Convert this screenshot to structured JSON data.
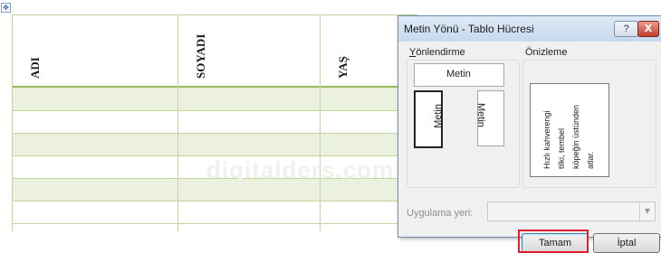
{
  "document": {
    "table": {
      "headers": [
        "ADI",
        "SOYADI",
        "YAŞ"
      ],
      "row_count": 6
    },
    "watermark": "digitalders.com"
  },
  "dialog": {
    "title": "Metin Yönü - Tablo Hücresi",
    "help_label": "?",
    "close_label": "X",
    "orientation": {
      "label_accel": "Y",
      "label_rest": "önlendirme",
      "options": [
        "Metin",
        "Metin",
        "Metin"
      ],
      "selected_index": 1
    },
    "preview": {
      "label": "Önizleme",
      "text_lines": [
        "Hızlı kahverengi",
        "tilki, tembel",
        "köpeğin üstünden",
        "atlar."
      ]
    },
    "apply": {
      "label": "Uygulama yeri:",
      "value": ""
    },
    "ok_label": "Tamam",
    "cancel_label": "İptal"
  },
  "colors": {
    "table_border": "#c2d69b",
    "table_band": "#ebf1de",
    "highlight": "#e0202c"
  }
}
